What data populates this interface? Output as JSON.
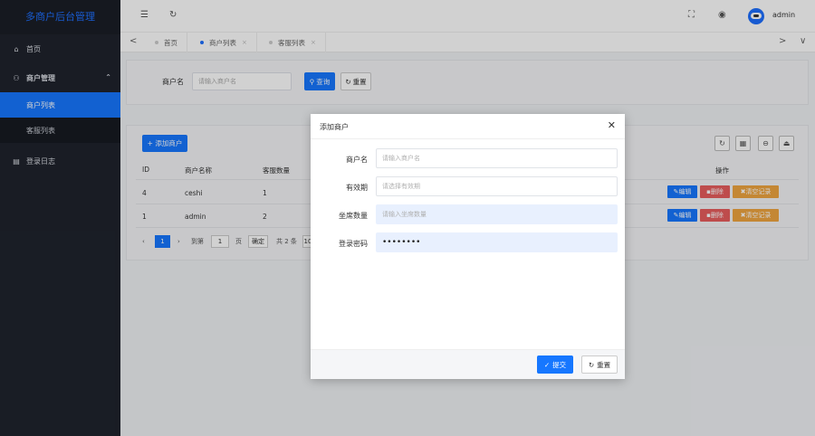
{
  "app": {
    "title": "多商户后台管理"
  },
  "sidebar": {
    "items": [
      {
        "label": "首页",
        "icon": "home-icon"
      },
      {
        "label": "商户管理",
        "icon": "user-icon",
        "children": [
          {
            "label": "商户列表",
            "active": true
          },
          {
            "label": "客服列表",
            "active": false
          }
        ]
      },
      {
        "label": "登录日志",
        "icon": "calendar-icon"
      }
    ]
  },
  "header": {
    "menu_icon": "☰",
    "refresh_icon": "↻",
    "fullscreen_icon": "⛶",
    "language_icon": "◉",
    "username": "admin"
  },
  "tabs": {
    "items": [
      {
        "label": "首页",
        "active": false
      },
      {
        "label": "商户列表",
        "active": true
      },
      {
        "label": "客服列表",
        "active": false
      }
    ],
    "close_icon": "×",
    "left_arrow": "<",
    "right_arrow": ">",
    "dropdown": "∨"
  },
  "search": {
    "label": "商户名",
    "placeholder": "请输入商户名",
    "search_button": "查询",
    "reset_button": "重置"
  },
  "table": {
    "add_button": "+ 添加商户",
    "columns": [
      "ID",
      "商户名称",
      "客服数量",
      "操作"
    ],
    "rows": [
      {
        "id": "4",
        "name": "ceshi",
        "count": "1"
      },
      {
        "id": "1",
        "name": "admin",
        "count": "2"
      }
    ],
    "actions": {
      "edit": "编辑",
      "delete": "删除",
      "clear": "清空记录"
    },
    "pager": {
      "current": "1",
      "goto": "到第",
      "page_value": "1",
      "page_unit": "页",
      "confirm": "确定",
      "total": "共 2 条",
      "size": "10"
    }
  },
  "modal": {
    "title": "添加商户",
    "fields": [
      {
        "label": "商户名",
        "placeholder": "请输入商户名",
        "value": ""
      },
      {
        "label": "有效期",
        "placeholder": "请选择有效期",
        "value": ""
      },
      {
        "label": "坐席数量",
        "placeholder": "请输入坐席数量",
        "value": ""
      },
      {
        "label": "登录密码",
        "placeholder": "",
        "value": "••••••••"
      }
    ],
    "submit_button": "提交",
    "reset_button": "重置"
  },
  "colors": {
    "primary": "#1677ff",
    "sidebar": "#1f232d",
    "danger": "#e85d5d",
    "warning": "#f0a540"
  }
}
